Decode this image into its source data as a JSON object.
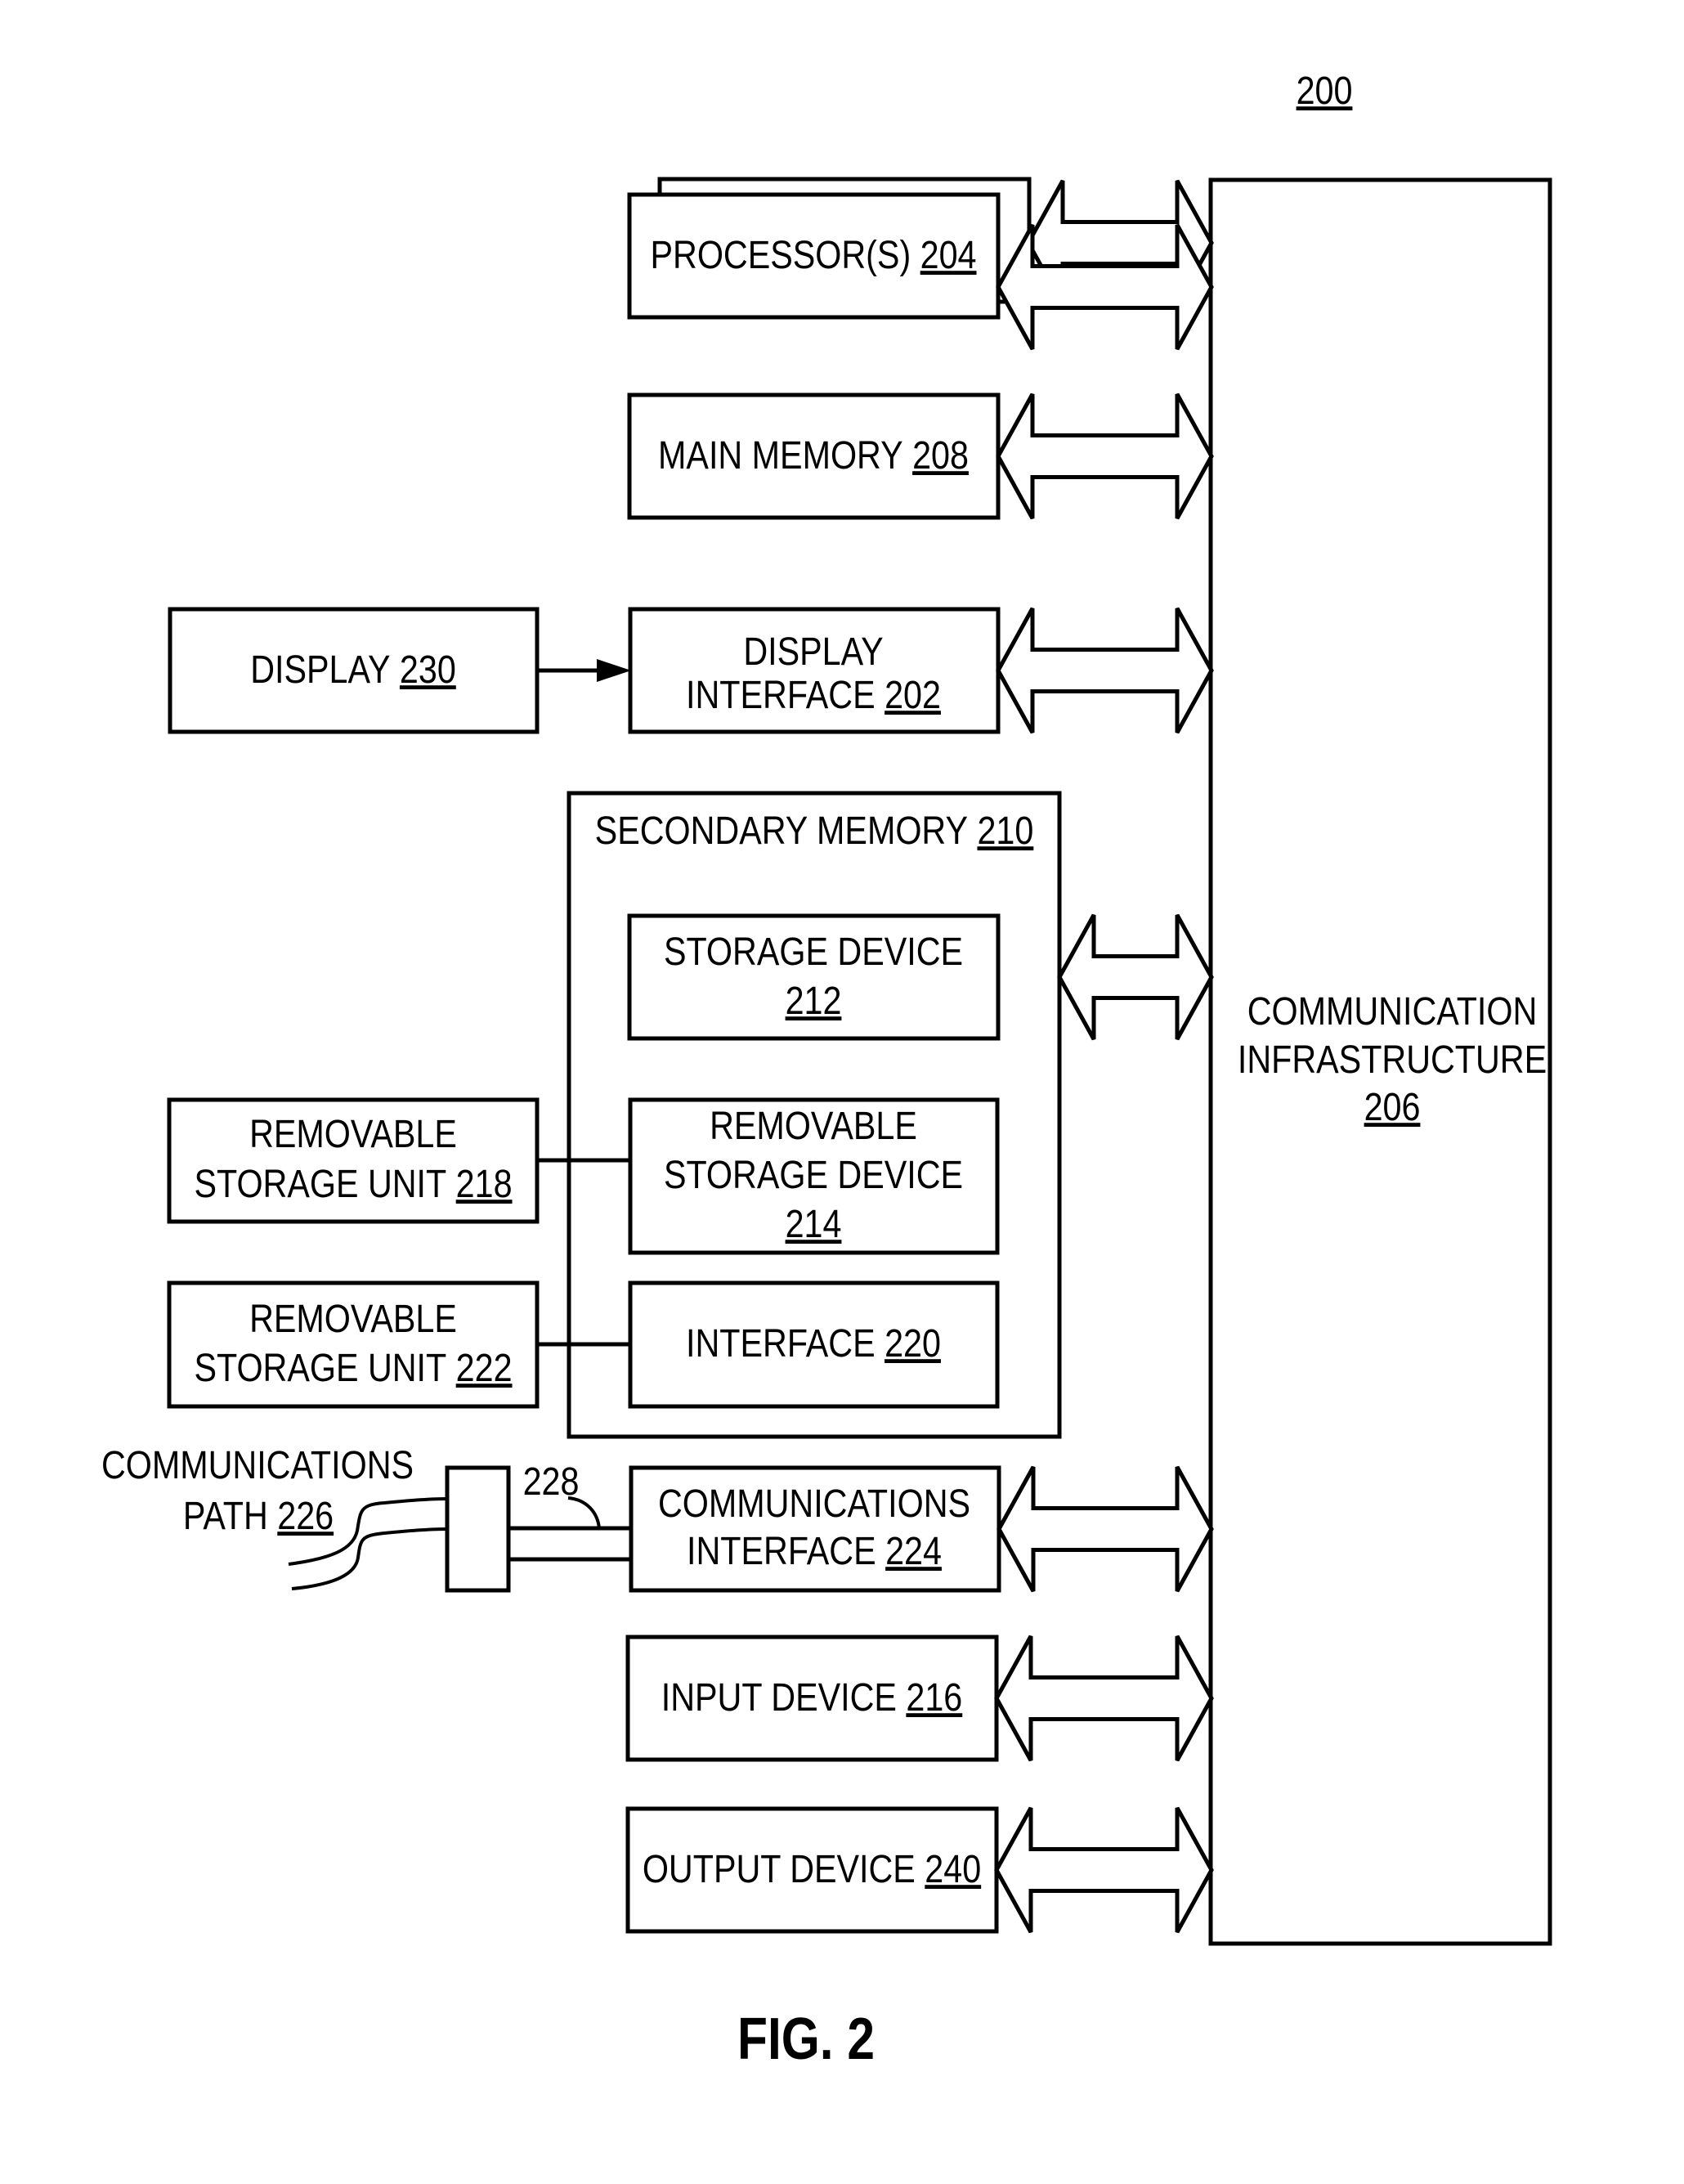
{
  "figure": {
    "reference_number": "200",
    "caption": "FIG. 2"
  },
  "blocks": {
    "processor": {
      "lines": [
        {
          "text": "PROCESSOR(S)",
          "ref": "204"
        }
      ]
    },
    "main_memory": {
      "lines": [
        {
          "text": "MAIN MEMORY",
          "ref": "208"
        }
      ]
    },
    "display": {
      "lines": [
        {
          "text": "DISPLAY",
          "ref": "230"
        }
      ]
    },
    "display_interface": {
      "lines": [
        {
          "text": "DISPLAY",
          "ref": ""
        },
        {
          "text": "INTERFACE",
          "ref": "202"
        }
      ]
    },
    "secondary_memory": {
      "lines": [
        {
          "text": "SECONDARY MEMORY",
          "ref": "210"
        }
      ]
    },
    "storage_device": {
      "lines": [
        {
          "text": "STORAGE DEVICE",
          "ref": ""
        },
        {
          "text": "",
          "ref": "212"
        }
      ]
    },
    "removable_storage_device": {
      "lines": [
        {
          "text": "REMOVABLE",
          "ref": ""
        },
        {
          "text": "STORAGE DEVICE",
          "ref": ""
        },
        {
          "text": "",
          "ref": "214"
        }
      ]
    },
    "removable_storage_unit_218": {
      "lines": [
        {
          "text": "REMOVABLE",
          "ref": ""
        },
        {
          "text": "STORAGE UNIT",
          "ref": "218"
        }
      ]
    },
    "removable_storage_unit_222": {
      "lines": [
        {
          "text": "REMOVABLE",
          "ref": ""
        },
        {
          "text": "STORAGE UNIT",
          "ref": "222"
        }
      ]
    },
    "interface": {
      "lines": [
        {
          "text": "INTERFACE",
          "ref": "220"
        }
      ]
    },
    "communications_interface": {
      "lines": [
        {
          "text": "COMMUNICATIONS",
          "ref": ""
        },
        {
          "text": "INTERFACE",
          "ref": "224"
        }
      ]
    },
    "input_device": {
      "lines": [
        {
          "text": "INPUT DEVICE",
          "ref": "216"
        }
      ]
    },
    "output_device": {
      "lines": [
        {
          "text": "OUTPUT DEVICE",
          "ref": "240"
        }
      ]
    },
    "communication_infrastructure": {
      "lines": [
        {
          "text": "COMMUNICATION",
          "ref": ""
        },
        {
          "text": "INFRASTRUCTURE",
          "ref": ""
        },
        {
          "text": "",
          "ref": "206"
        }
      ]
    }
  },
  "labels": {
    "communications_path": {
      "lines": [
        {
          "text": "COMMUNICATIONS",
          "ref": ""
        },
        {
          "text": "PATH",
          "ref": "226"
        }
      ]
    },
    "channel_ref": "228"
  },
  "colors": {
    "ink": "#000000",
    "paper": "#ffffff"
  }
}
